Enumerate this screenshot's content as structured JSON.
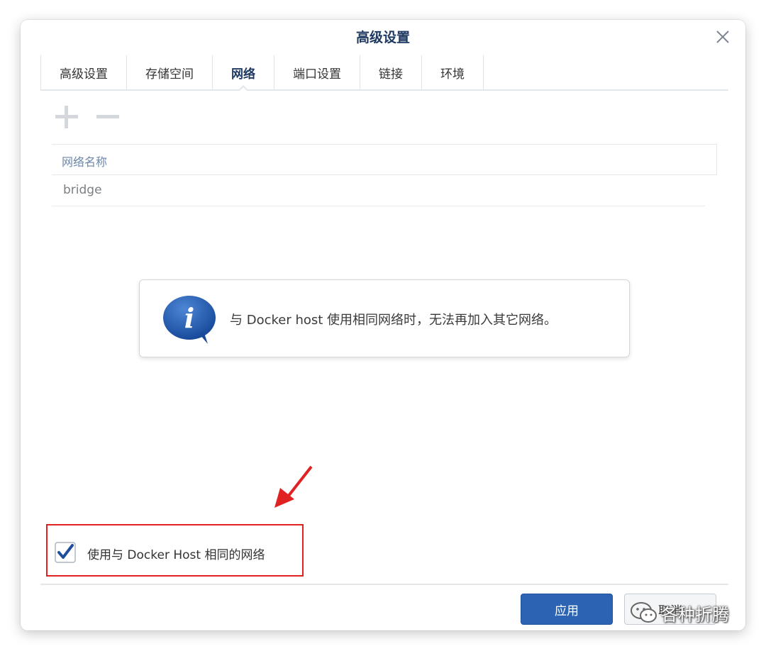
{
  "dialog": {
    "title": "高级设置"
  },
  "tabs": [
    {
      "label": "高级设置",
      "active": false
    },
    {
      "label": "存储空间",
      "active": false
    },
    {
      "label": "网络",
      "active": true
    },
    {
      "label": "端口设置",
      "active": false
    },
    {
      "label": "链接",
      "active": false
    },
    {
      "label": "环境",
      "active": false
    }
  ],
  "toolbar": {
    "add_icon": "plus-icon",
    "remove_icon": "minus-icon"
  },
  "table": {
    "columns": [
      "网络名称"
    ],
    "rows": [
      [
        "bridge"
      ]
    ]
  },
  "info": {
    "icon": "info-icon",
    "message": "与 Docker host 使用相同网络时，无法再加入其它网络。"
  },
  "host_network": {
    "checked": true,
    "label": "使用与 Docker Host 相同的网络"
  },
  "buttons": {
    "apply": "应用",
    "cancel": "取消"
  },
  "watermark": {
    "text": "各种折腾"
  },
  "colors": {
    "accent": "#2c64b3",
    "title": "#1f3a61",
    "highlight_frame": "#e02222",
    "arrow": "#e02222"
  }
}
